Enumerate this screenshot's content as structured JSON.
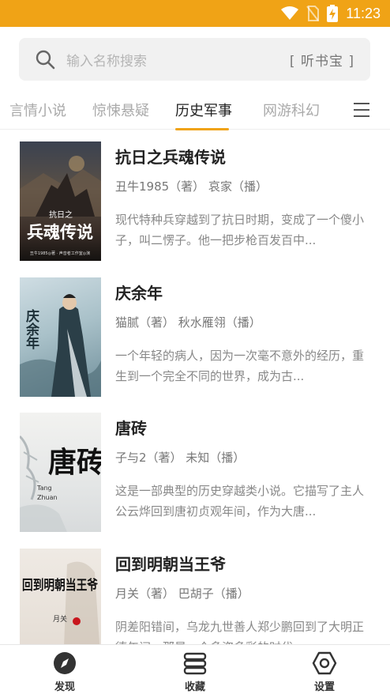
{
  "status_bar": {
    "time": "11:23"
  },
  "search": {
    "placeholder": "输入名称搜索",
    "source": "[ 听书宝 ]"
  },
  "tabs": [
    {
      "label": "言情小说",
      "active": false
    },
    {
      "label": "惊悚悬疑",
      "active": false
    },
    {
      "label": "历史军事",
      "active": true
    },
    {
      "label": "网游科幻",
      "active": false
    }
  ],
  "books": [
    {
      "title": "抗日之兵魂传说",
      "meta": "丑牛1985（著） 哀家（播）",
      "description": "现代特种兵穿越到了抗日时期，变成了一个傻小子，叫二愣子。他一把步枪百发百中...",
      "cover_text": "兵魂传说",
      "cover_small": "抗日之",
      "cover_footer": "丑牛1985◎著 · 声音者工作室◎演"
    },
    {
      "title": "庆余年",
      "meta": "猫腻（著） 秋水雁翎（播）",
      "description": "一个年轻的病人，因为一次毫不意外的经历，重生到一个完全不同的世界，成为古...",
      "cover_text": "庆余年"
    },
    {
      "title": "唐砖",
      "meta": "子与2（著） 未知（播）",
      "description": "这是一部典型的历史穿越类小说。它描写了主人公云烨回到唐初贞观年间，作为大唐...",
      "cover_text": "唐砖",
      "cover_pinyin_1": "Tang",
      "cover_pinyin_2": "Zhuan"
    },
    {
      "title": "回到明朝当王爷",
      "meta": "月关（著） 巴胡子（播）",
      "description": "阴差阳错间，乌龙九世善人郑少鹏回到了大明正德年间，那是一个多姿多彩的时代...",
      "cover_text": "回到明朝当王爷",
      "cover_author": "月关"
    }
  ],
  "bottom_nav": [
    {
      "label": "发现",
      "icon": "compass-icon"
    },
    {
      "label": "收藏",
      "icon": "stack-icon"
    },
    {
      "label": "设置",
      "icon": "hexagon-gear-icon"
    }
  ],
  "colors": {
    "accent": "#f0a316",
    "search_bg": "#f1f1f1"
  }
}
